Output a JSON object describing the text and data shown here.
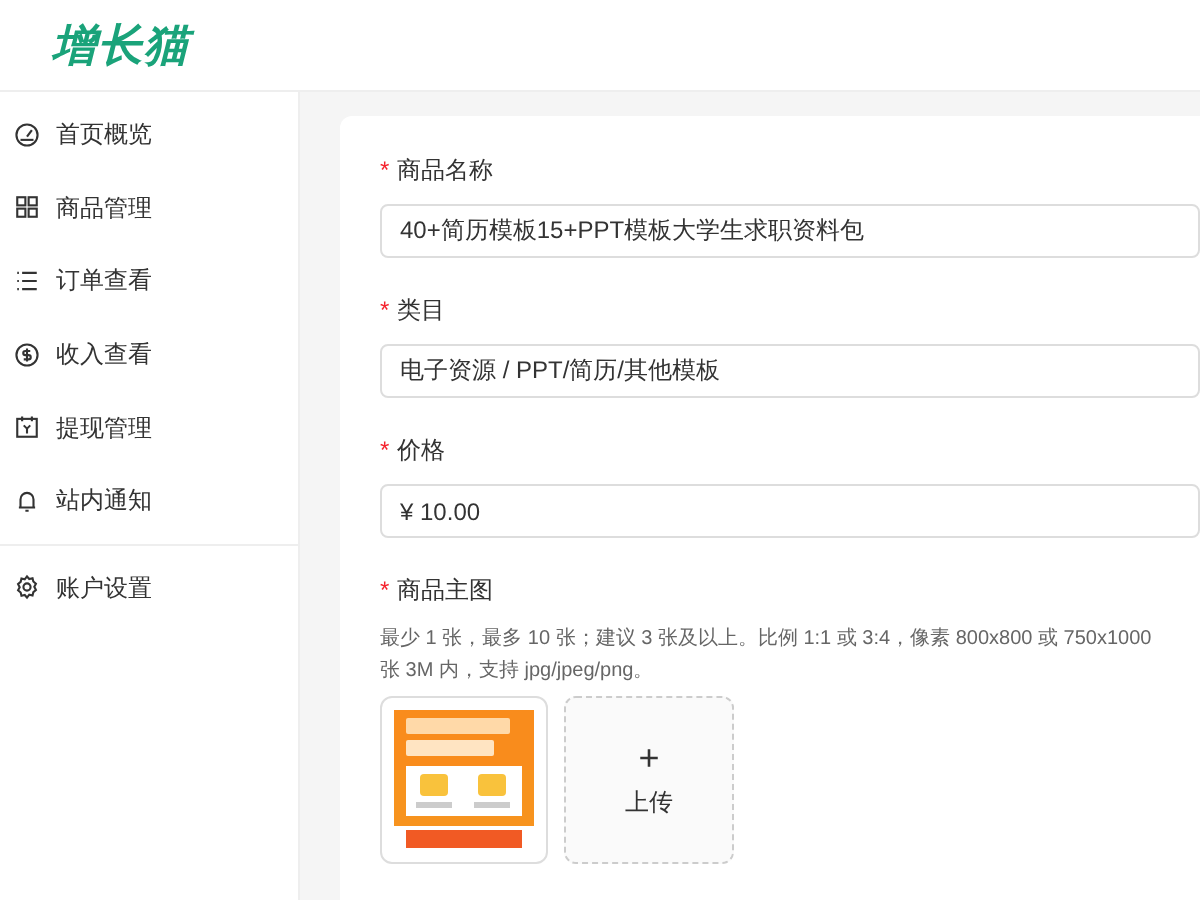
{
  "logo": "增长猫",
  "sidebar": {
    "groups": [
      {
        "items": [
          {
            "label": "首页概览"
          },
          {
            "label": "商品管理"
          },
          {
            "label": "订单查看"
          },
          {
            "label": "收入查看"
          },
          {
            "label": "提现管理"
          },
          {
            "label": "站内通知"
          }
        ]
      },
      {
        "items": [
          {
            "label": "账户设置"
          }
        ]
      }
    ]
  },
  "form": {
    "fields": [
      {
        "kind": "input",
        "label": "商品名称",
        "required_mark": "*",
        "value": "40+简历模板15+PPT模板大学生求职资料包"
      },
      {
        "kind": "input",
        "label": "类目",
        "required_mark": "*",
        "value": "电子资源 / PPT/简历/其他模板"
      },
      {
        "kind": "input",
        "label": "价格",
        "required_mark": "*",
        "value": "¥ 10.00"
      },
      {
        "kind": "images",
        "label": "商品主图",
        "required_mark": "*",
        "hint_lines": [
          "最少 1 张，最多 10 张；建议 3 张及以上。比例 1:1 或 3:4，像素 800x800 或 750x1000",
          "张 3M 内，支持 jpg/jpeg/png。"
        ],
        "upload": {
          "symbol": "+",
          "label": "上传"
        }
      }
    ]
  }
}
